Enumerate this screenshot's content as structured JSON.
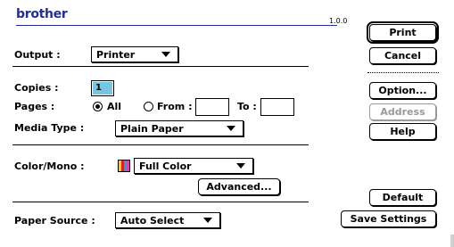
{
  "header": {
    "logo": "brother",
    "version": "1.0.0"
  },
  "output": {
    "label": "Output :",
    "value": "Printer"
  },
  "copies": {
    "label": "Copies :",
    "value": "1"
  },
  "pages": {
    "label": "Pages :",
    "all_label": "All",
    "from_label": "From :",
    "to_label": "To :",
    "selected": "All"
  },
  "media_type": {
    "label": "Media Type :",
    "value": "Plain Paper"
  },
  "color_mono": {
    "label": "Color/Mono :",
    "value": "Full Color",
    "icon_colors": [
      "#f0d020",
      "#e02020",
      "#20a0e0",
      "#e040b0",
      "#000000"
    ]
  },
  "paper_source": {
    "label": "Paper Source :",
    "value": "Auto Select"
  },
  "buttons": {
    "print": "Print",
    "cancel": "Cancel",
    "option": "Option...",
    "address": "Address",
    "help": "Help",
    "advanced": "Advanced...",
    "default": "Default",
    "save_settings": "Save Settings"
  }
}
